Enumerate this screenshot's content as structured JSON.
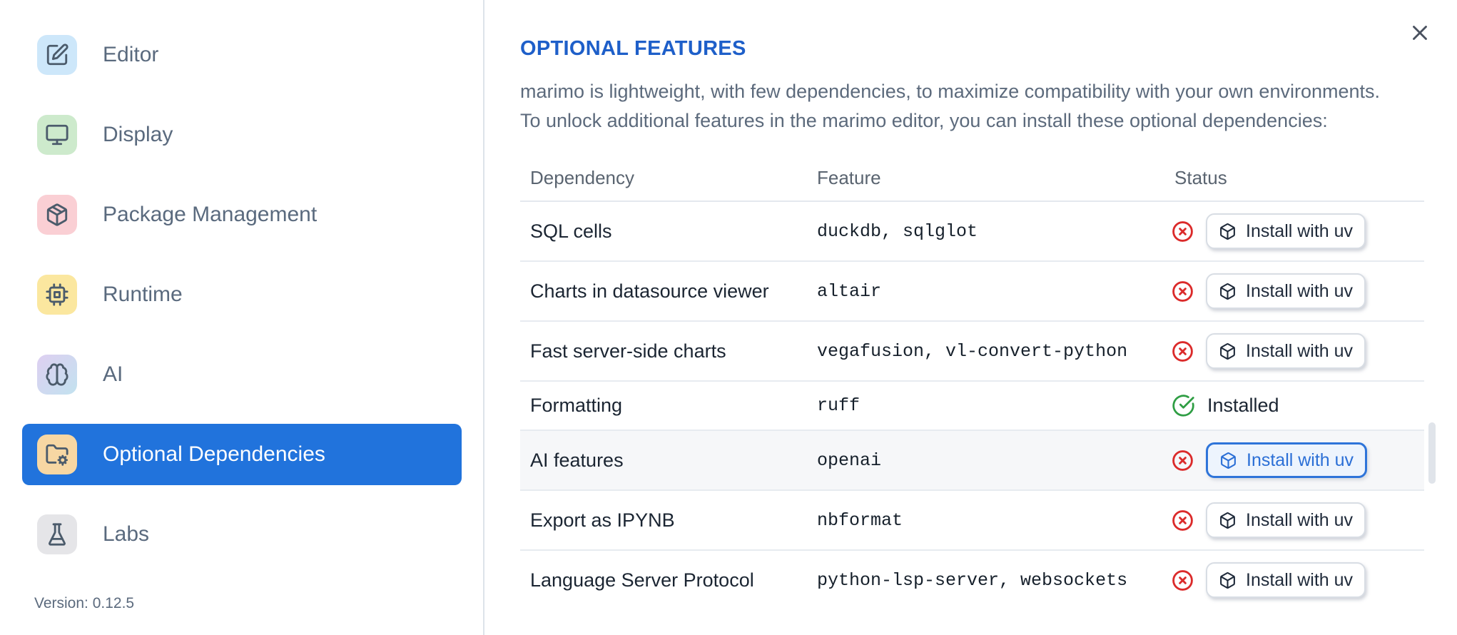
{
  "dialog": {
    "close_icon": "x-icon"
  },
  "colors": {
    "accent_blue": "#2173dc",
    "title_blue": "#1e5fc9",
    "danger_red": "#db2b2b",
    "success_green": "#2f9e44",
    "focus_blue": "#2b6fd6",
    "focus_blue_border": "#2e74d9",
    "focus_blue_bg": "#edf4fd"
  },
  "sidebar": {
    "items": [
      {
        "label": "Editor",
        "slug": "editor",
        "icon": "pencil-square-icon",
        "tile_color": "#cde7fa",
        "selected": false
      },
      {
        "label": "Display",
        "slug": "display",
        "icon": "monitor-icon",
        "tile_color": "#cdeacc",
        "selected": false
      },
      {
        "label": "Package Management",
        "slug": "package-management",
        "icon": "package-icon",
        "tile_color": "#facfd4",
        "selected": false
      },
      {
        "label": "Runtime",
        "slug": "runtime",
        "icon": "cpu-icon",
        "tile_color": "#fbe79f",
        "selected": false
      },
      {
        "label": "AI",
        "slug": "ai",
        "icon": "brain-icon",
        "tile_gradient": [
          "#decff1",
          "#c2e2ef"
        ],
        "selected": false
      },
      {
        "label": "Optional Dependencies",
        "slug": "optional-dependencies",
        "icon": "folder-gear-icon",
        "tile_color": "#f7d7a3",
        "selected": true
      },
      {
        "label": "Labs",
        "slug": "labs",
        "icon": "flask-icon",
        "tile_color": "#e5e5e8",
        "selected": false
      }
    ],
    "version_label": "Version: 0.12.5"
  },
  "header": {
    "title": "OPTIONAL FEATURES",
    "description_lines": [
      "marimo is lightweight, with few dependencies, to maximize compatibility with your own environments.",
      "To unlock additional features in the marimo editor, you can install these optional dependencies:"
    ]
  },
  "table": {
    "columns": [
      "Dependency",
      "Feature",
      "Status"
    ],
    "install_button_label": "Install with uv",
    "installed_label": "Installed",
    "status_icons": {
      "not_installed": "circle-x-icon",
      "installed": "circle-check-icon"
    },
    "install_button_icon": "box-icon",
    "rows": [
      {
        "dependency": "SQL cells",
        "feature": "duckdb, sqlglot",
        "status": "not_installed"
      },
      {
        "dependency": "Charts in datasource viewer",
        "feature": "altair",
        "status": "not_installed"
      },
      {
        "dependency": "Fast server-side charts",
        "feature": "vegafusion, vl-convert-python",
        "status": "not_installed"
      },
      {
        "dependency": "Formatting",
        "feature": "ruff",
        "status": "installed"
      },
      {
        "dependency": "AI features",
        "feature": "openai",
        "status": "not_installed",
        "highlighted": true,
        "button_focused": true
      },
      {
        "dependency": "Export as IPYNB",
        "feature": "nbformat",
        "status": "not_installed"
      },
      {
        "dependency": "Language Server Protocol",
        "feature": "python-lsp-server, websockets",
        "status": "not_installed"
      }
    ]
  }
}
